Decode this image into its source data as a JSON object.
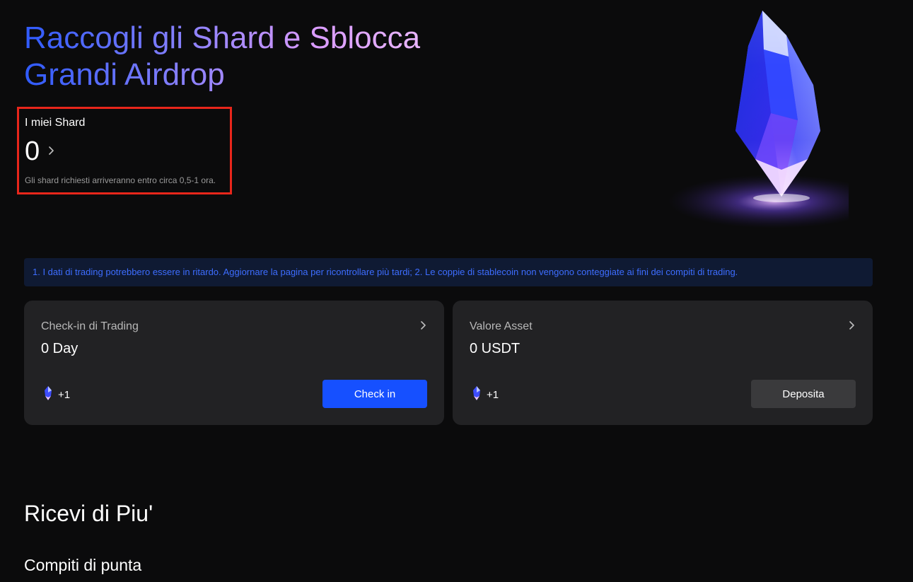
{
  "hero": {
    "title": "Raccogli gli Shard e Sblocca Grandi Airdrop"
  },
  "shards": {
    "label": "I miei Shard",
    "count": "0",
    "note": "Gli shard richiesti arriveranno entro circa 0,5-1 ora."
  },
  "notice": {
    "text": "1. I dati di trading potrebbero essere in ritardo. Aggiornare la pagina per ricontrollare più tardi; 2. Le coppie di stablecoin non vengono conteggiate ai fini dei compiti di trading."
  },
  "cards": [
    {
      "title": "Check-in di Trading",
      "value": "0 Day",
      "reward": "+1",
      "button": "Check in"
    },
    {
      "title": "Valore Asset",
      "value": "0 USDT",
      "reward": "+1",
      "button": "Deposita"
    }
  ],
  "sections": {
    "more_title": "Ricevi di Piu'",
    "top_tasks_title": "Compiti di punta"
  },
  "icons": {
    "chevron": "chevron-right-icon",
    "shard": "shard-gem-icon"
  },
  "colors": {
    "background": "#0b0b0c",
    "card": "#222224",
    "accent_blue": "#1650ff",
    "notice_text": "#3d6dff",
    "highlight_border": "#e8261b"
  }
}
